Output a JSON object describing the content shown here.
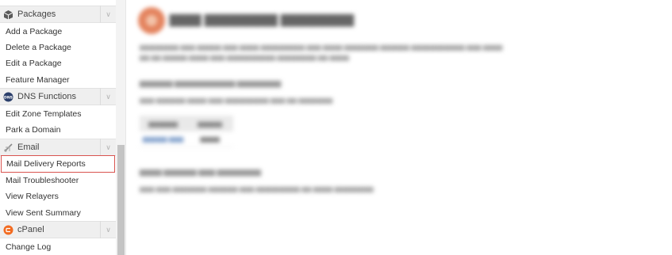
{
  "sidebar": {
    "groups": [
      {
        "id": "packages",
        "title": "Packages",
        "icon": "package-icon",
        "items": [
          "Add a Package",
          "Delete a Package",
          "Edit a Package",
          "Feature Manager"
        ]
      },
      {
        "id": "dns",
        "title": "DNS Functions",
        "icon": "dns-icon",
        "icon_text": "DNS",
        "items": [
          "Edit Zone Templates",
          "Park a Domain"
        ]
      },
      {
        "id": "email",
        "title": "Email",
        "icon": "email-icon",
        "items": [
          "Mail Delivery Reports",
          "Mail Troubleshooter",
          "View Relayers",
          "View Sent Summary"
        ]
      },
      {
        "id": "cpanel",
        "title": "cPanel",
        "icon": "cpanel-icon",
        "items": [
          "Change Log"
        ]
      }
    ],
    "selected_item": "Mail Delivery Reports",
    "collapse_glyph": "∨"
  },
  "colors": {
    "selected_border": "#d9534f",
    "cpanel_orange": "#f26b21",
    "dns_badge": "#2b3f6b"
  }
}
